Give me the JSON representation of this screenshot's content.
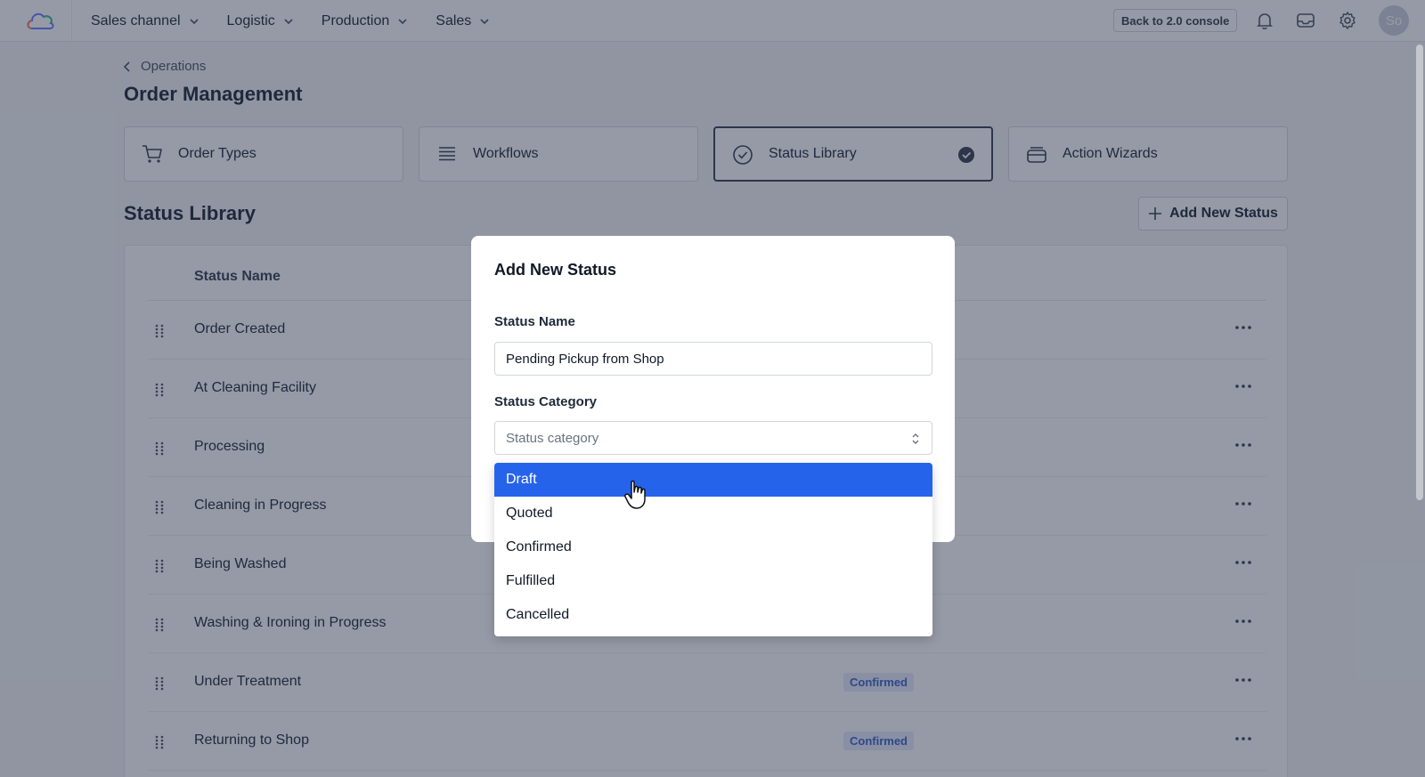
{
  "topbar": {
    "nav": [
      "Sales channel",
      "Logistic",
      "Production",
      "Sales"
    ],
    "console_button": "Back to 2.0 console",
    "avatar_initials": "So"
  },
  "breadcrumb": "Operations",
  "page_title": "Order Management",
  "cards": [
    {
      "label": "Order Types",
      "icon": "cart-icon",
      "selected": false
    },
    {
      "label": "Workflows",
      "icon": "list-icon",
      "selected": false
    },
    {
      "label": "Status Library",
      "icon": "check-circle-icon",
      "selected": true
    },
    {
      "label": "Action Wizards",
      "icon": "wizard-icon",
      "selected": false
    }
  ],
  "section": {
    "title": "Status Library",
    "add_button": "Add New Status"
  },
  "table": {
    "header": "Status Name",
    "rows": [
      {
        "name": "Order Created",
        "category": ""
      },
      {
        "name": "At Cleaning Facility",
        "category": ""
      },
      {
        "name": "Processing",
        "category": ""
      },
      {
        "name": "Cleaning in Progress",
        "category": ""
      },
      {
        "name": "Being Washed",
        "category": ""
      },
      {
        "name": "Washing & Ironing in Progress",
        "category": ""
      },
      {
        "name": "Under Treatment",
        "category": "Confirmed"
      },
      {
        "name": "Returning to Shop",
        "category": "Confirmed"
      }
    ]
  },
  "modal": {
    "title": "Add New Status",
    "name_label": "Status Name",
    "name_value": "Pending Pickup from Shop",
    "category_label": "Status Category",
    "category_placeholder": "Status category"
  },
  "dropdown": {
    "options": [
      "Draft",
      "Quoted",
      "Confirmed",
      "Fulfilled",
      "Cancelled"
    ],
    "highlighted": "Draft"
  },
  "colors": {
    "accent": "#2563eb",
    "badge_bg": "#e6ecfb",
    "badge_text": "#3b64c9"
  }
}
